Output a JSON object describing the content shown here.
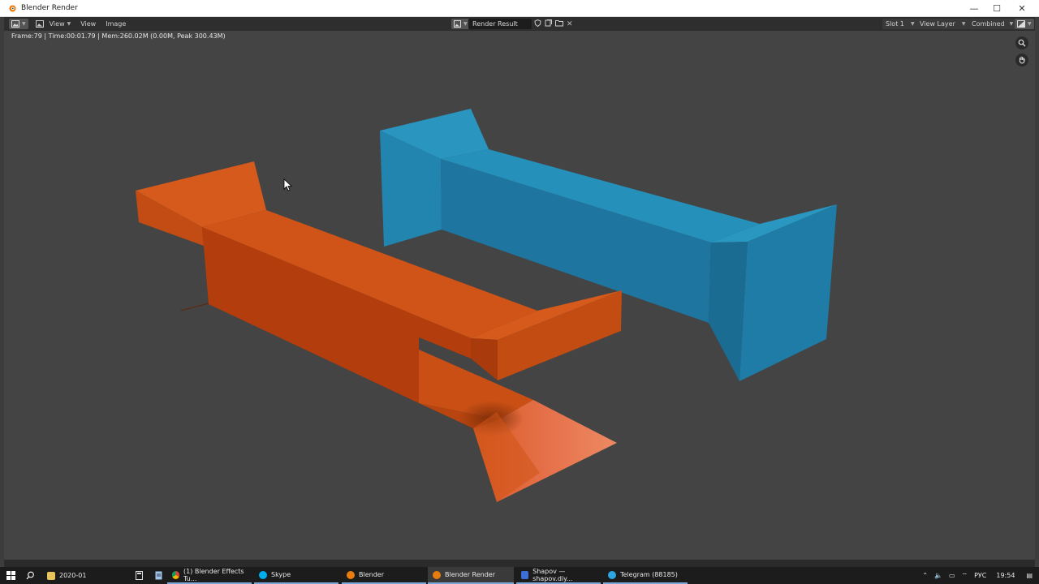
{
  "window": {
    "title": "Blender Render",
    "controls": {
      "minimize": "—",
      "maximize": "☐",
      "close": "✕"
    }
  },
  "header": {
    "view_menu": "View",
    "menu_view": "View",
    "menu_image": "Image",
    "image_name": "Render Result",
    "slot": "Slot 1",
    "view_layer": "View Layer",
    "pass": "Combined"
  },
  "viewport": {
    "info": "Frame:79 | Time:00:01.79 | Mem:260.02M (0.00M, Peak 300.43M)",
    "colors": {
      "orange_object": "#d4571a",
      "blue_object": "#2388b2",
      "background": "#444444"
    }
  },
  "taskbar": {
    "items": [
      {
        "label": "2020-01",
        "icon": "folder-icon"
      },
      {
        "label": "(1) Blender Effects Tu...",
        "icon": "chrome-icon"
      },
      {
        "label": "Skype",
        "icon": "skype-icon"
      },
      {
        "label": "Blender",
        "icon": "blender-icon"
      },
      {
        "label": "Blender Render",
        "icon": "blender-icon"
      },
      {
        "label": "Shapov — shapov.diy...",
        "icon": "browser-icon"
      },
      {
        "label": "Telegram (88185)",
        "icon": "telegram-icon"
      }
    ],
    "tray": {
      "language": "РУС",
      "time": "19:54"
    }
  }
}
